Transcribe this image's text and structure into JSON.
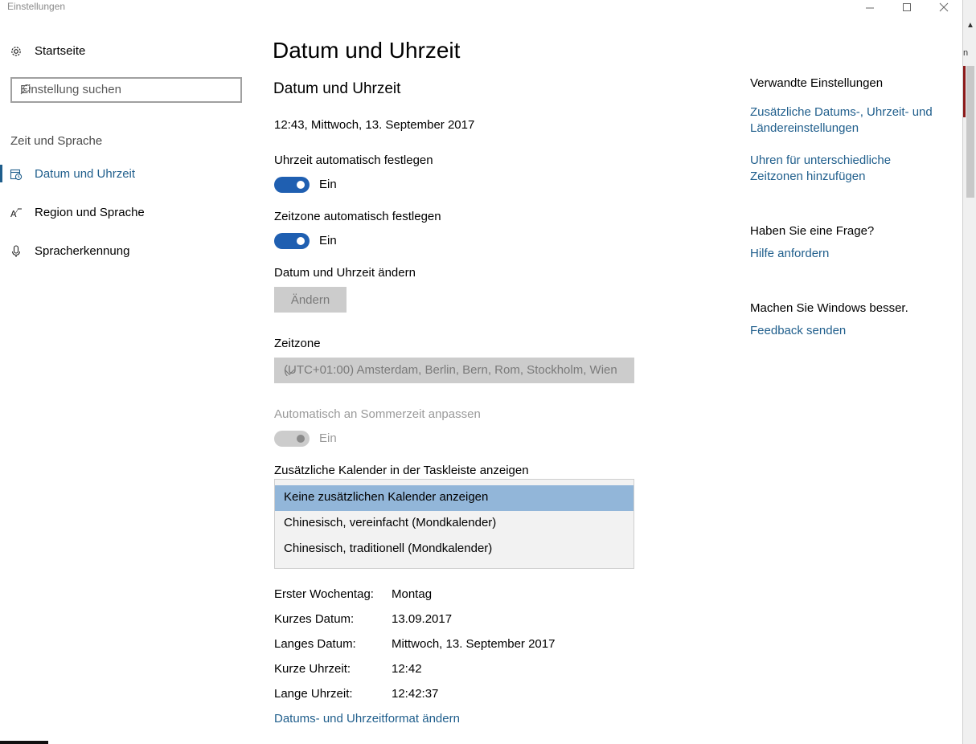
{
  "window": {
    "title": "Einstellungen",
    "controls": {
      "minimize": "minimize-icon",
      "maximize": "maximize-icon",
      "close": "close-icon"
    }
  },
  "background_window": {
    "letter": "n"
  },
  "sidebar": {
    "home_label": "Startseite",
    "search_placeholder": "Einstellung suchen",
    "section_title": "Zeit und Sprache",
    "items": [
      {
        "label": "Datum und Uhrzeit",
        "icon": "calendar-clock-icon",
        "active": true
      },
      {
        "label": "Region und Sprache",
        "icon": "region-language-icon",
        "active": false
      },
      {
        "label": "Spracherkennung",
        "icon": "microphone-icon",
        "active": false
      }
    ]
  },
  "main": {
    "page_title": "Datum und Uhrzeit",
    "section_title": "Datum und Uhrzeit",
    "current_datetime": "12:43, Mittwoch, 13. September 2017",
    "auto_time": {
      "label": "Uhrzeit automatisch festlegen",
      "state": "Ein",
      "on": true
    },
    "auto_timezone": {
      "label": "Zeitzone automatisch festlegen",
      "state": "Ein",
      "on": true
    },
    "change_datetime": {
      "label": "Datum und Uhrzeit ändern",
      "button": "Ändern"
    },
    "timezone": {
      "label": "Zeitzone",
      "value": "(UTC+01:00) Amsterdam, Berlin, Bern, Rom, Stockholm, Wien"
    },
    "dst": {
      "label": "Automatisch an Sommerzeit anpassen",
      "state": "Ein",
      "on": true,
      "disabled": true
    },
    "calendars": {
      "label": "Zusätzliche Kalender in der Taskleiste anzeigen",
      "options": [
        "Keine zusätzlichen Kalender anzeigen",
        "Chinesisch, vereinfacht (Mondkalender)",
        "Chinesisch, traditionell (Mondkalender)"
      ],
      "selected_index": 0
    },
    "formats": [
      {
        "label": "Erster Wochentag:",
        "value": "Montag"
      },
      {
        "label": "Kurzes Datum:",
        "value": "13.09.2017"
      },
      {
        "label": "Langes Datum:",
        "value": "Mittwoch, 13. September 2017"
      },
      {
        "label": "Kurze Uhrzeit:",
        "value": "12:42"
      },
      {
        "label": "Lange Uhrzeit:",
        "value": "12:42:37"
      }
    ],
    "format_link": "Datums- und Uhrzeitformat ändern"
  },
  "related": {
    "title": "Verwandte Einstellungen",
    "links": [
      "Zusätzliche Datums-, Uhrzeit- und Ländereinstellungen",
      "Uhren für unterschiedliche Zeitzonen hinzufügen"
    ],
    "question_title": "Haben Sie eine Frage?",
    "help_link": "Hilfe anfordern",
    "improve_title": "Machen Sie Windows besser.",
    "feedback_link": "Feedback senden"
  },
  "colors": {
    "accent": "#1f5e8c",
    "toggle_on": "#1f5fb1",
    "disabled": "#cccccc",
    "selected_option": "#92b6d9"
  }
}
